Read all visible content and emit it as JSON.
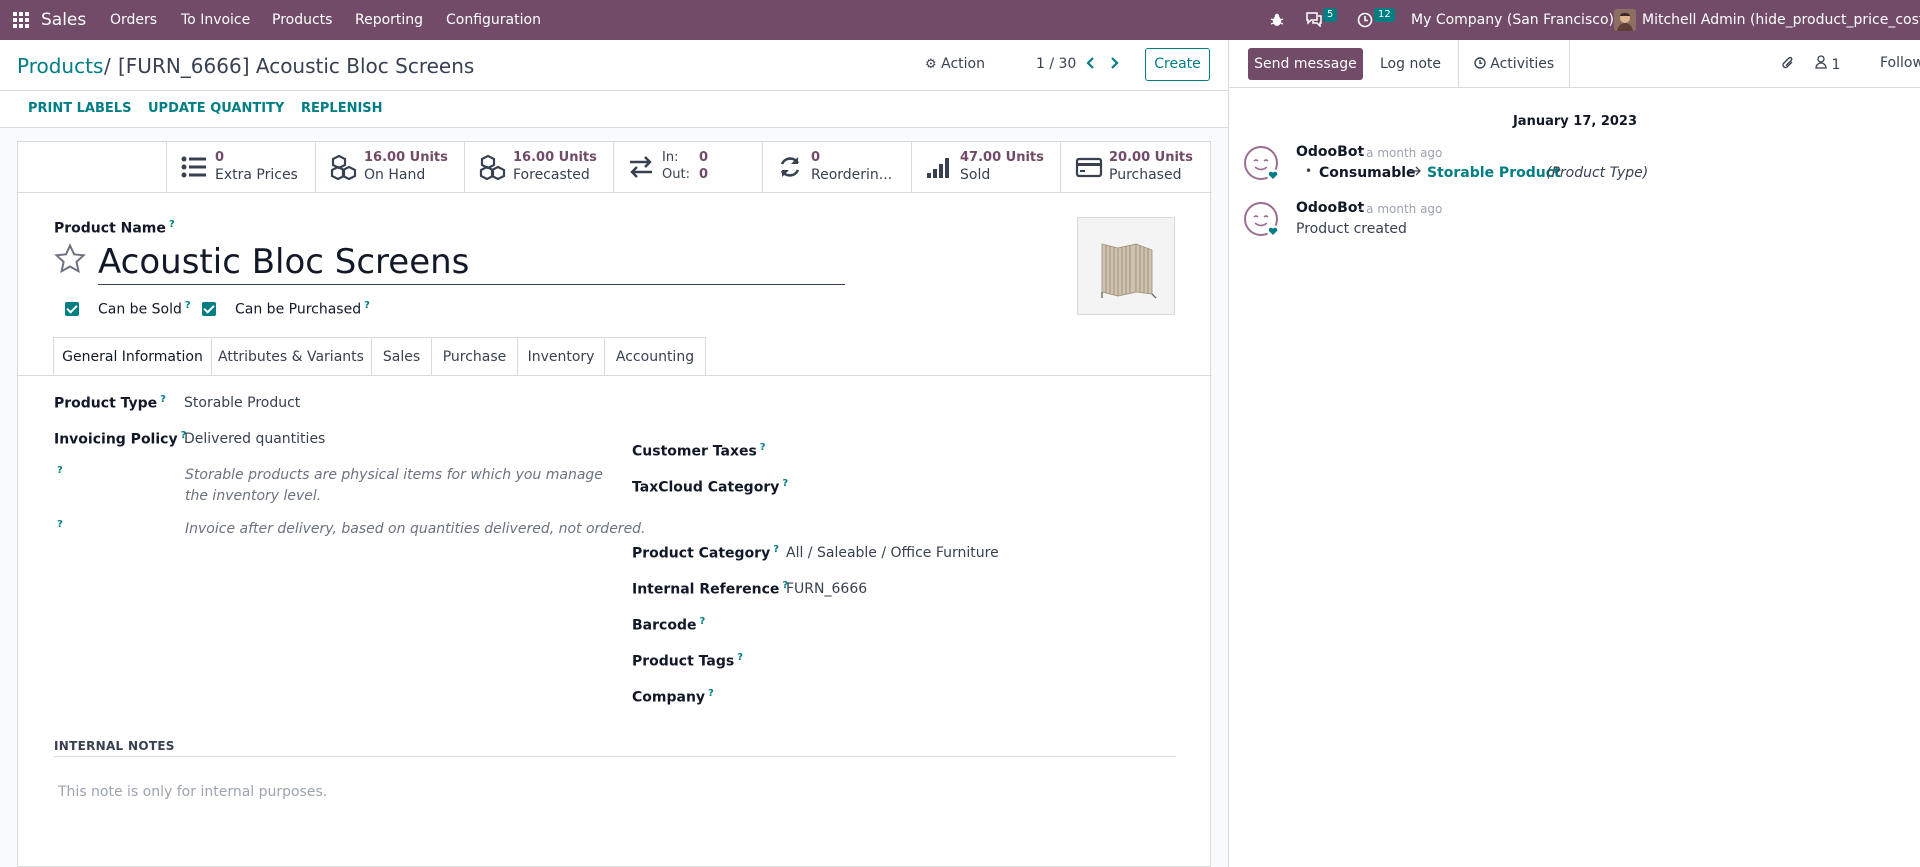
{
  "navbar": {
    "app_name": "Sales",
    "menu": [
      "Orders",
      "To Invoice",
      "Products",
      "Reporting",
      "Configuration"
    ],
    "messages_count": "5",
    "activities_count": "12",
    "company": "My Company (San Francisco)",
    "user": "Mitchell Admin (hide_product_price_cost)"
  },
  "control": {
    "breadcrumb_root": "Products",
    "breadcrumb_sep": "/",
    "breadcrumb_current": "[FURN_6666] Acoustic Bloc Screens",
    "action_label": "Action",
    "pager": "1 / 30",
    "create_label": "Create",
    "buttons": [
      "PRINT LABELS",
      "UPDATE QUANTITY",
      "REPLENISH"
    ]
  },
  "stats": [
    {
      "value": "0",
      "label": "Extra Prices",
      "icon": "list-icon"
    },
    {
      "value": "16.00 Units",
      "label": "On Hand",
      "icon": "cubes-icon"
    },
    {
      "value": "16.00 Units",
      "label": "Forecasted",
      "icon": "cubes-icon"
    },
    {
      "in_label": "In:",
      "in_value": "0",
      "out_label": "Out:",
      "out_value": "0",
      "icon": "exchange-icon"
    },
    {
      "value": "0",
      "label": "Reorderin...",
      "icon": "refresh-icon"
    },
    {
      "value": "47.00 Units",
      "label": "Sold",
      "icon": "signal-icon"
    },
    {
      "value": "20.00 Units",
      "label": "Purchased",
      "icon": "credit-card-icon"
    }
  ],
  "product": {
    "name_label": "Product Name",
    "name": "Acoustic Bloc Screens",
    "can_be_sold": "Can be Sold",
    "can_be_purchased": "Can be Purchased",
    "help_mark": "?"
  },
  "tabs": [
    "General Information",
    "Attributes & Variants",
    "Sales",
    "Purchase",
    "Inventory",
    "Accounting"
  ],
  "general": {
    "product_type_label": "Product Type",
    "product_type": "Storable Product",
    "invoicing_policy_label": "Invoicing Policy",
    "invoicing_policy": "Delivered quantities",
    "help1": "Storable products are physical items for which you manage the inventory level.",
    "help2": "Invoice after delivery, based on quantities delivered, not ordered.",
    "customer_taxes_label": "Customer Taxes",
    "taxcloud_label": "TaxCloud Category",
    "category_label": "Product Category",
    "category": "All / Saleable / Office Furniture",
    "internal_ref_label": "Internal Reference",
    "internal_ref": "FURN_6666",
    "barcode_label": "Barcode",
    "tags_label": "Product Tags",
    "company_label": "Company",
    "notes_heading": "INTERNAL NOTES",
    "notes_placeholder": "This note is only for internal purposes."
  },
  "chatter": {
    "send_message": "Send message",
    "log_note": "Log note",
    "activities": "Activities",
    "followers_count": "1",
    "follow": "Follow",
    "date": "January 17, 2023",
    "messages": [
      {
        "author": "OdooBot",
        "time": "- a month ago",
        "old": "Consumable",
        "new": "Storable Product",
        "field": "(Product Type)"
      },
      {
        "author": "OdooBot",
        "time": "- a month ago",
        "body": "Product created"
      }
    ]
  },
  "colors": {
    "brand": "#714B67",
    "accent": "#017E84"
  }
}
